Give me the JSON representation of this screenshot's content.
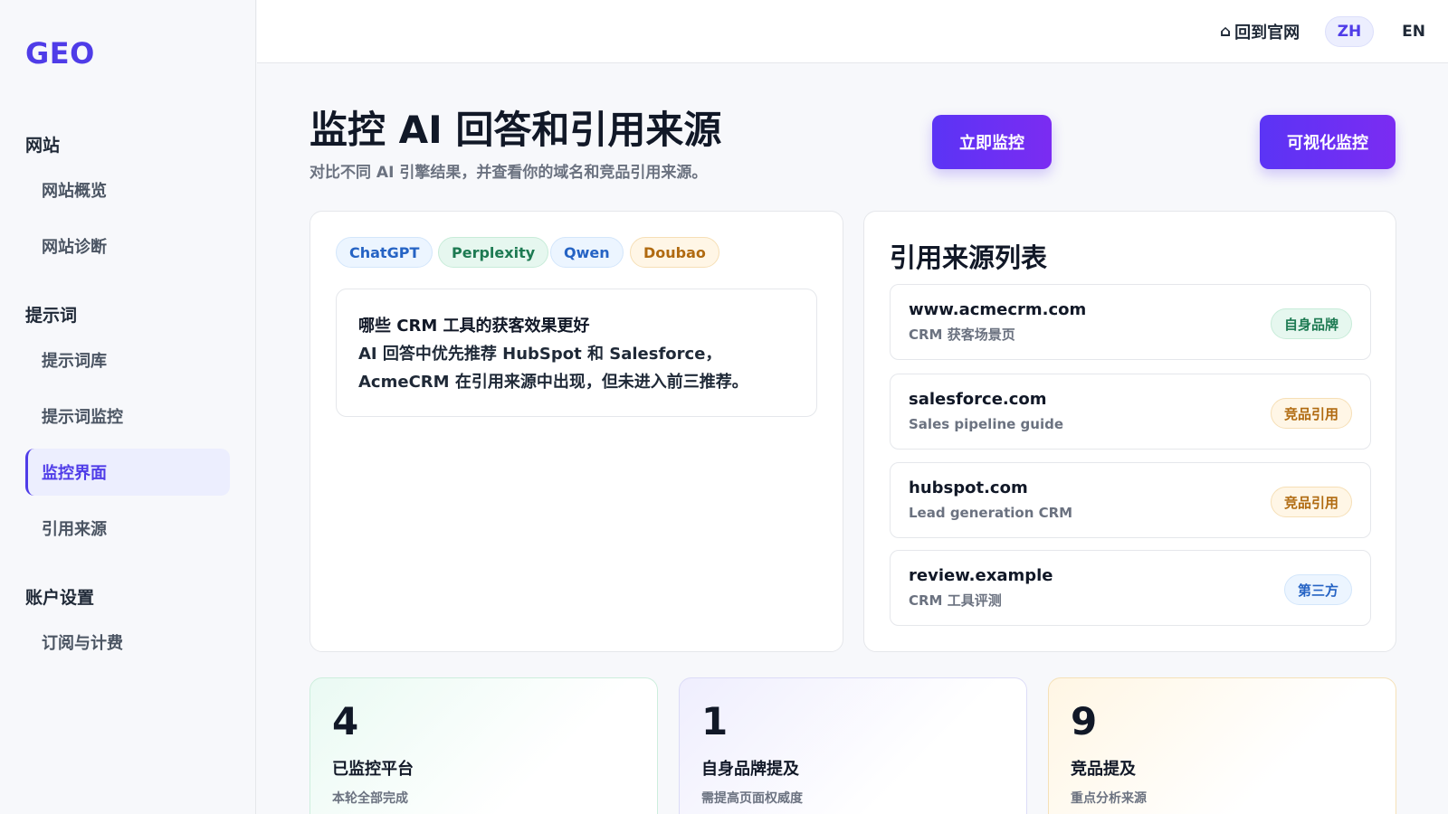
{
  "sidebar": {
    "logo": "GEO",
    "groups": [
      {
        "title": "网站",
        "items": [
          "网站概览",
          "网站诊断"
        ]
      },
      {
        "title": "提示词",
        "items": [
          "提示词库",
          "提示词监控",
          "监控界面",
          "引用来源"
        ]
      },
      {
        "title": "账户设置",
        "items": [
          "订阅与计费"
        ]
      }
    ],
    "active_item": "监控界面"
  },
  "topbar": {
    "home_link": "回到官网",
    "lang_zh": "ZH",
    "lang_en": "EN",
    "active_lang": "ZH"
  },
  "header": {
    "title": "监控 AI 回答和引用来源",
    "subtitle": "对比不同 AI 引擎结果，并查看你的域名和竞品引用来源。",
    "monitor_button": "立即监控",
    "visual_button": "可视化监控"
  },
  "engines": [
    "ChatGPT",
    "Perplexity",
    "Qwen",
    "Doubao"
  ],
  "answer": {
    "question": "哪些 CRM 工具的获客效果更好",
    "text": "AI 回答中优先推荐 HubSpot 和 Salesforce，AcmeCRM 在引用来源中出现，但未进入前三推荐。"
  },
  "sources": {
    "title": "引用来源列表",
    "items": [
      {
        "domain": "www.acmecrm.com",
        "desc": "CRM 获客场景页",
        "tag": "自身品牌"
      },
      {
        "domain": "salesforce.com",
        "desc": "Sales pipeline guide",
        "tag": "竞品引用"
      },
      {
        "domain": "hubspot.com",
        "desc": "Lead generation CRM",
        "tag": "竞品引用"
      },
      {
        "domain": "review.example",
        "desc": "CRM 工具评测",
        "tag": "第三方"
      }
    ]
  },
  "stats": [
    {
      "value": "4",
      "label": "已监控平台",
      "note": "本轮全部完成"
    },
    {
      "value": "1",
      "label": "自身品牌提及",
      "note": "需提高页面权威度"
    },
    {
      "value": "9",
      "label": "竞品提及",
      "note": "重点分析来源"
    }
  ],
  "colors": {
    "accent": "#4f3ce8",
    "button_gradient_start": "#5b34f5",
    "button_gradient_end": "#7b2cf2",
    "own_brand": "#1d7a52",
    "competitor": "#b06a10",
    "third_party": "#2563c4"
  },
  "icons": {
    "home_link": "home-icon"
  }
}
